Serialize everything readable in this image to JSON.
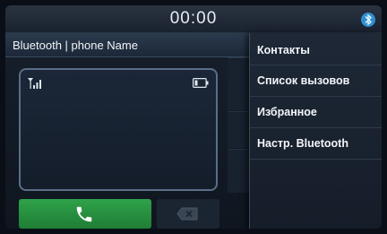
{
  "status": {
    "clock": "00:00",
    "bluetooth_icon": "bluetooth-connected-icon"
  },
  "header": {
    "title": "Bluetooth | phone Name"
  },
  "phone_panel": {
    "signal_icon": "signal-strength-icon",
    "battery_icon": "battery-icon"
  },
  "actions": {
    "call_icon": "phone-call-icon",
    "delete_icon": "backspace-icon"
  },
  "menu": {
    "items": [
      {
        "label": "Контакты"
      },
      {
        "label": "Список вызовов"
      },
      {
        "label": "Избранное"
      },
      {
        "label": "Настр. Bluetooth"
      }
    ]
  },
  "colors": {
    "call": "#2a9a45",
    "accent": "#3fa6e0",
    "text": "#f2f5f8"
  }
}
